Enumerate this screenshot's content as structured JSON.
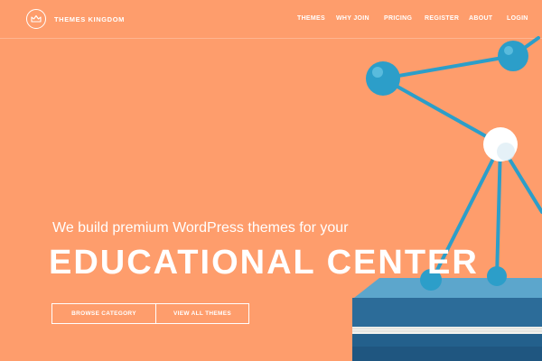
{
  "brand": {
    "name": "THEMES KINGDOM",
    "logo_icon": "crown-icon"
  },
  "nav": {
    "items": [
      {
        "label": "THEMES"
      },
      {
        "label": "WHY JOIN"
      },
      {
        "label": "PRICING"
      },
      {
        "label": "REGISTER"
      },
      {
        "label": "ABOUT"
      },
      {
        "label": "LOGIN"
      }
    ]
  },
  "hero": {
    "tagline": "We build premium WordPress themes for your",
    "headline": "EDUCATIONAL CENTER",
    "buttons": {
      "browse": "BROWSE CATEGORY",
      "view_all": "VIEW ALL THEMES"
    }
  },
  "colors": {
    "background": "#fe9d6c",
    "molecule_blue": "#2c9ec9",
    "book_blue": "#2c6c99",
    "text": "#ffffff"
  }
}
